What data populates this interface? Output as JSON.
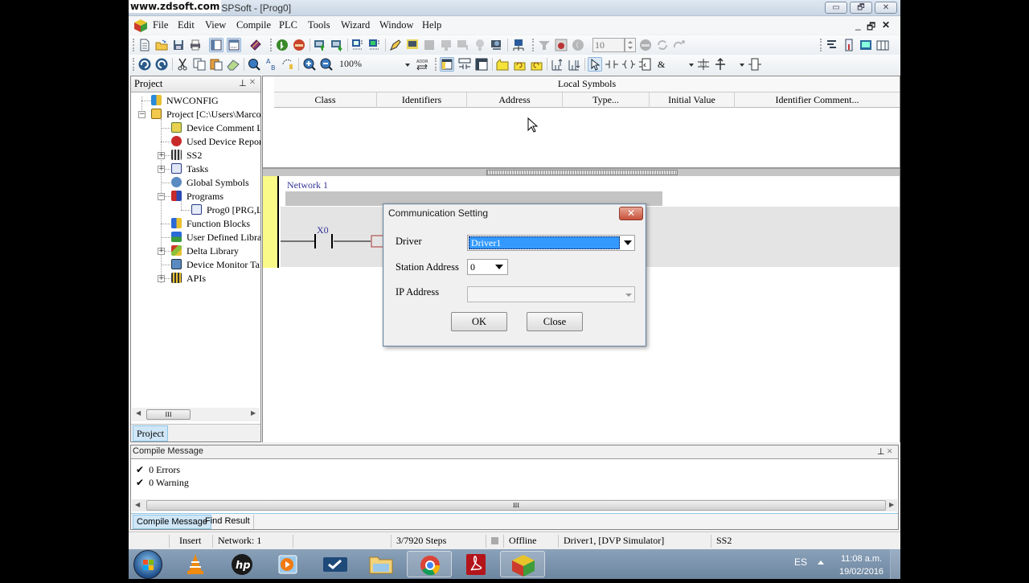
{
  "window": {
    "watermark": "www.zdsoft.com",
    "title": "a ISPSoft - [Prog0]",
    "controls": {
      "minimize": "▭",
      "restore": "🗗",
      "close": "✕"
    }
  },
  "menu": {
    "items": [
      "File",
      "Edit",
      "View",
      "Compile",
      "PLC",
      "Tools",
      "Wizard",
      "Window",
      "Help"
    ],
    "mdi_controls": {
      "minimize": "_",
      "restore": "🗗",
      "close": "✕"
    }
  },
  "toolbar": {
    "zoom_level": "100%",
    "step_value": "10"
  },
  "project_panel": {
    "title": "Project",
    "pin": "⊥",
    "close": "×",
    "tab": "Project",
    "tree": [
      {
        "label": "NWCONFIG",
        "icon": "network-config-icon",
        "level": 0
      },
      {
        "label": "Project [C:\\Users\\Marco.",
        "icon": "project-icon",
        "level": 0,
        "expanded": true
      },
      {
        "label": "Device Comment L",
        "icon": "device-comment-icon",
        "level": 1
      },
      {
        "label": "Used Device Repor",
        "icon": "used-device-report-icon",
        "level": 1
      },
      {
        "label": "SS2",
        "icon": "plc-hardware-icon",
        "level": 1,
        "expandable": true
      },
      {
        "label": "Tasks",
        "icon": "tasks-icon",
        "level": 1,
        "expandable": true
      },
      {
        "label": "Global Symbols",
        "icon": "global-symbols-icon",
        "level": 1
      },
      {
        "label": "Programs",
        "icon": "programs-icon",
        "level": 1,
        "expanded": true
      },
      {
        "label": "Prog0 [PRG,L",
        "icon": "program-pou-icon",
        "level": 2
      },
      {
        "label": "Function Blocks",
        "icon": "function-blocks-icon",
        "level": 1
      },
      {
        "label": "User Defined Librar",
        "icon": "user-library-icon",
        "level": 1
      },
      {
        "label": "Delta Library",
        "icon": "delta-library-icon",
        "level": 1,
        "expandable": true
      },
      {
        "label": "Device Monitor Ta",
        "icon": "device-monitor-icon",
        "level": 1
      },
      {
        "label": "APIs",
        "icon": "apis-icon",
        "level": 1,
        "expandable": true
      }
    ]
  },
  "local_symbols": {
    "title": "Local Symbols",
    "columns": [
      "Class",
      "Identifiers",
      "Address",
      "Type...",
      "Initial Value",
      "Identifier Comment..."
    ]
  },
  "ladder": {
    "network_label": "Network 1",
    "contact_label": "X0"
  },
  "dialog": {
    "title": "Communication Setting",
    "close": "✕",
    "driver_label": "Driver",
    "driver_value": "Driver1",
    "station_label": "Station Address",
    "station_value": "0",
    "ip_label": "IP Address",
    "ip_value": "",
    "ok_label": "OK",
    "close_label": "Close"
  },
  "compile_panel": {
    "title": "Compile Message",
    "pin": "⊥",
    "close": "×",
    "messages": [
      {
        "check": "✔",
        "text": "0 Errors"
      },
      {
        "check": "✔",
        "text": "0 Warning"
      }
    ],
    "tabs": [
      "Compile Message",
      "Find Result"
    ]
  },
  "statusbar": {
    "mode": "Insert",
    "network": "Network: 1",
    "steps": "3/7920 Steps",
    "connection": "Offline",
    "driver": "Driver1, [DVP Simulator]",
    "plc_model": "SS2"
  },
  "taskbar": {
    "apps": [
      "start",
      "vlc",
      "hp",
      "media-player",
      "task-app",
      "file-explorer",
      "chrome",
      "acrobat",
      "ispsoft"
    ],
    "language": "ES",
    "time": "11:08 a.m.",
    "date": "19/02/2016"
  },
  "colors": {
    "selection": "#3399ff",
    "ladder_label": "#333399",
    "network_bar": "#fafa88"
  }
}
